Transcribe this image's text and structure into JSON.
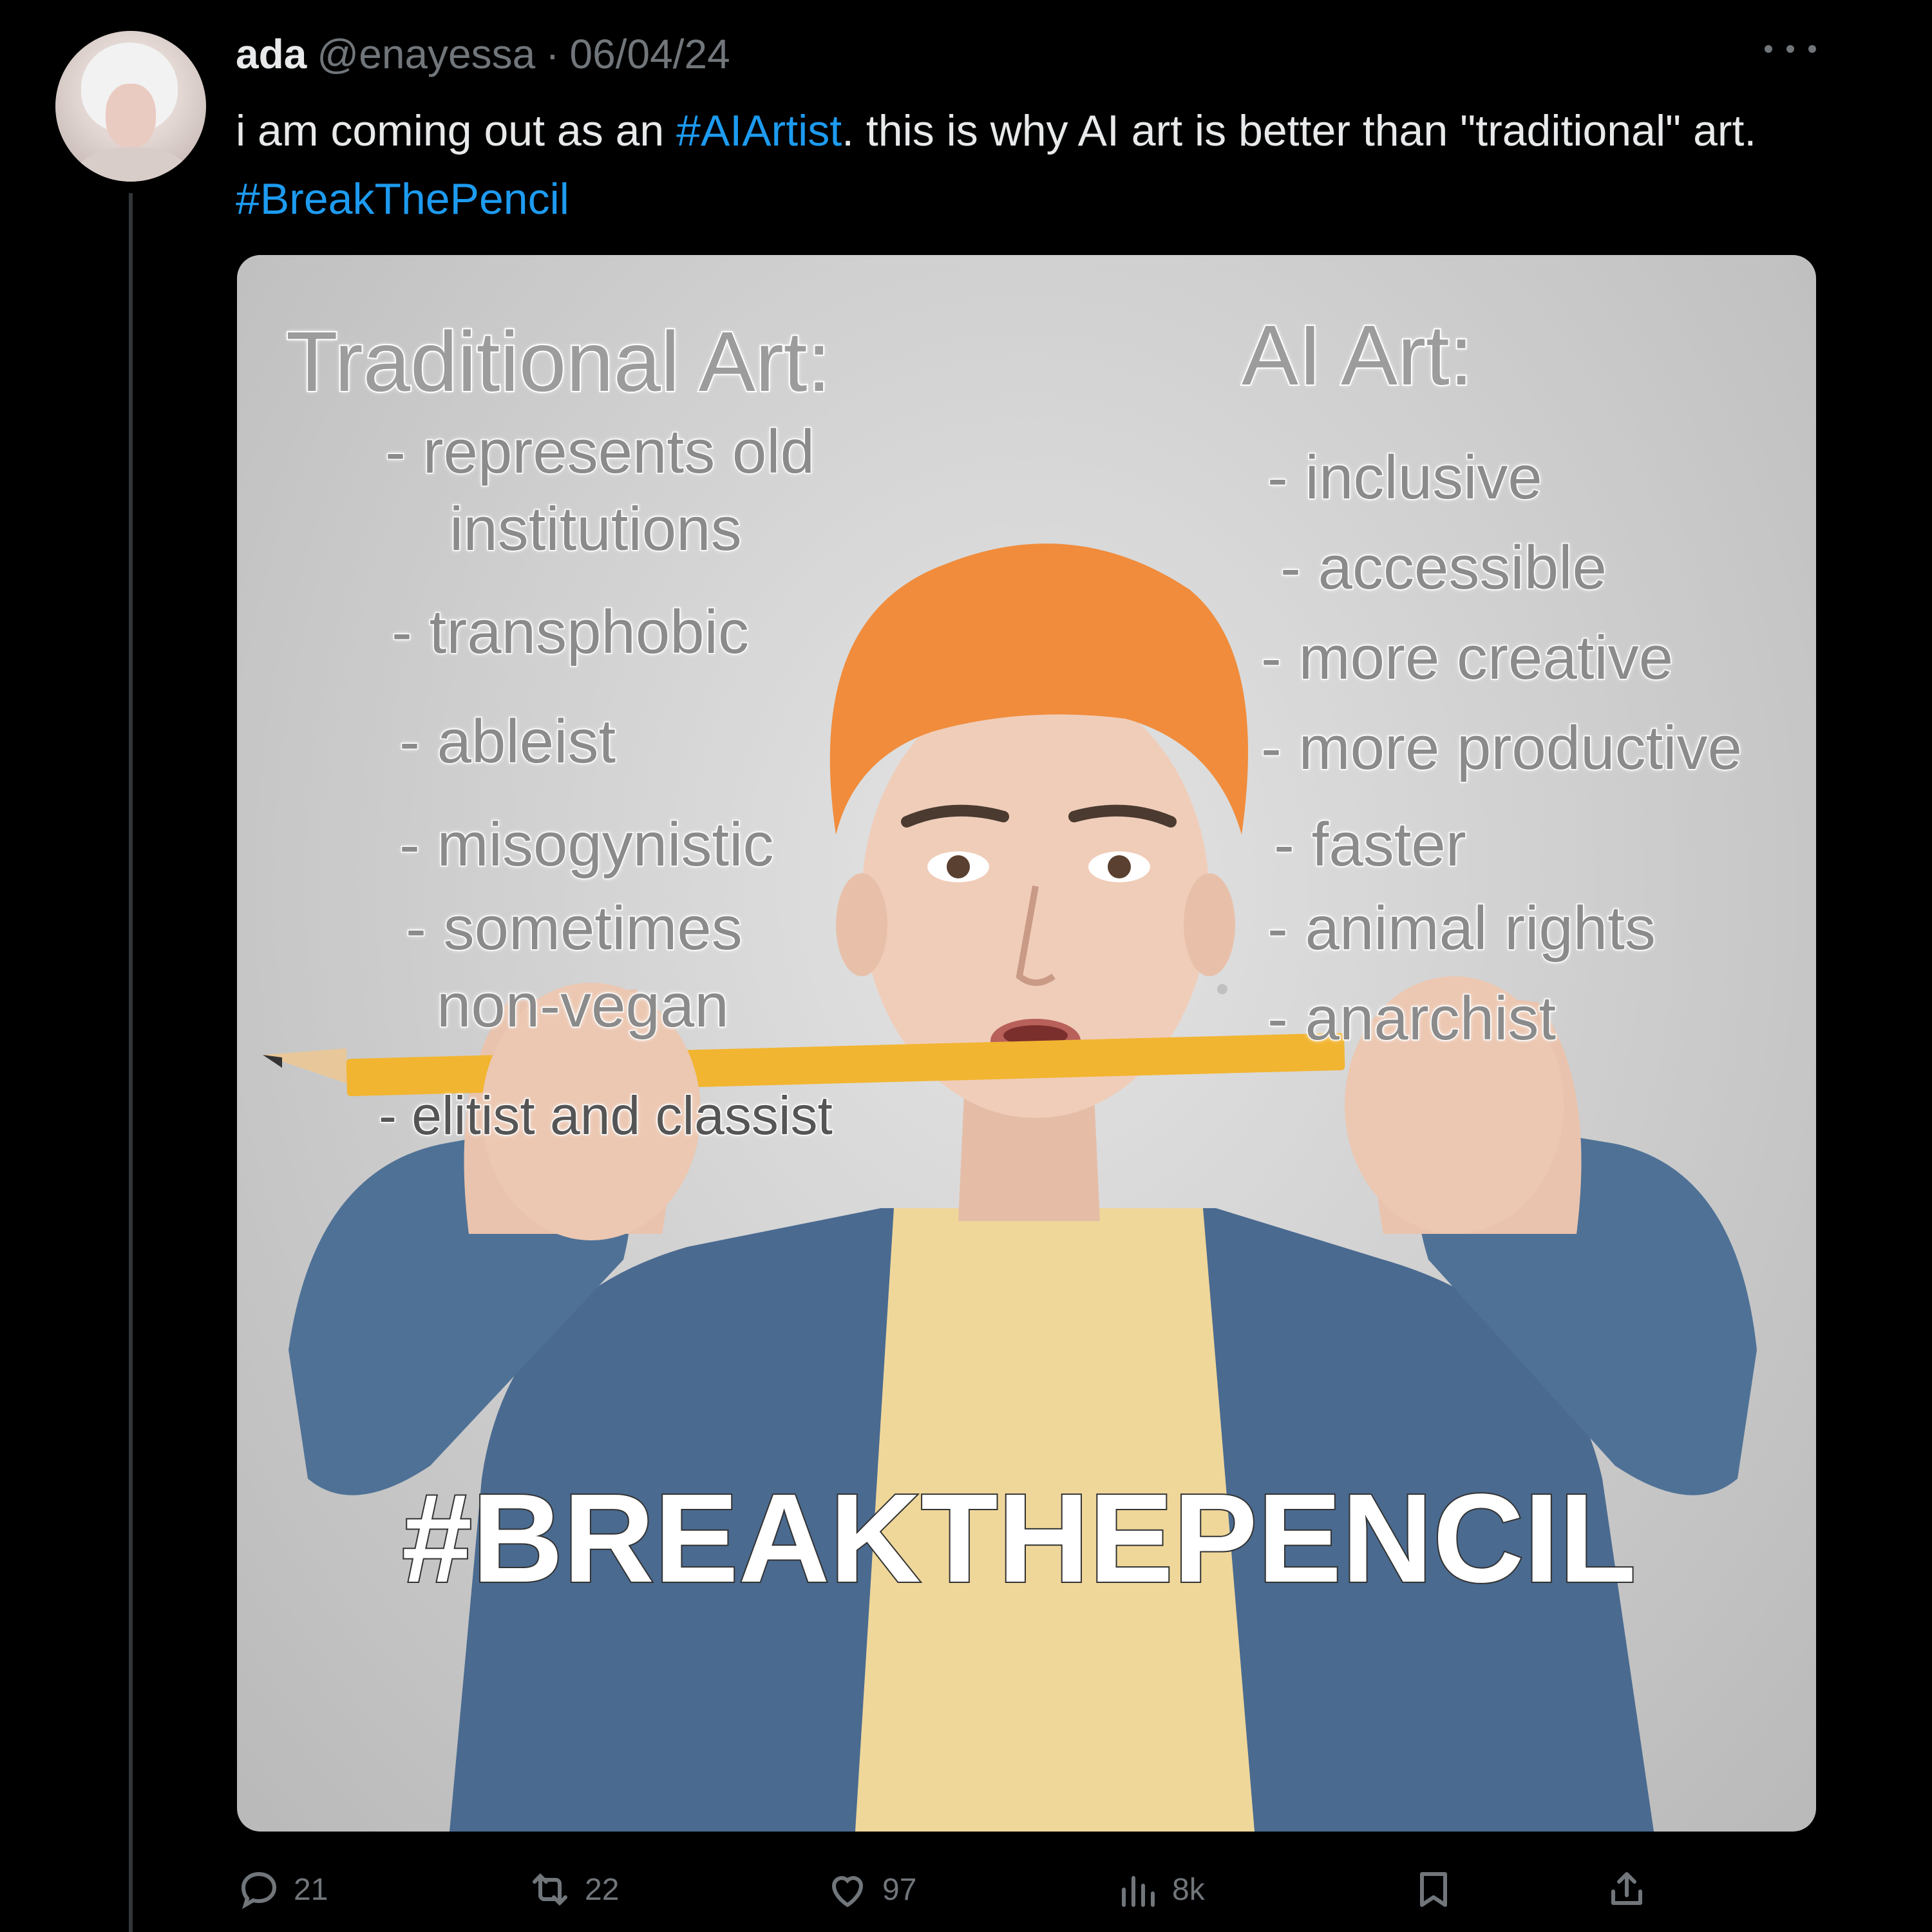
{
  "tweet": {
    "display_name": "ada",
    "handle": "@enayessa",
    "separator": "·",
    "date": "06/04/24",
    "text_part1": "i am coming out as an ",
    "hashtag1": "#AIArtist",
    "text_part2": ". this is why AI art is better than \"traditional\" art. ",
    "hashtag2": "#BreakThePencil"
  },
  "media": {
    "left_heading": "Traditional Art:",
    "left_items": [
      "- represents old",
      "institutions",
      "- transphobic",
      "- ableist",
      "- misogynistic",
      "- sometimes",
      "non-vegan",
      "- elitist and classist"
    ],
    "right_heading": "AI Art:",
    "right_items": [
      "- inclusive",
      "- accessible",
      "- more creative",
      "- more productive",
      "- faster",
      "- animal rights",
      "- anarchist"
    ],
    "banner": "#BREAKTHEPENCIL"
  },
  "actions": {
    "replies": "21",
    "reposts": "22",
    "likes": "97",
    "views": "8k"
  },
  "colors": {
    "background": "#000000",
    "text": "#e7e9ea",
    "secondary": "#71767b",
    "link": "#1d9bf0"
  }
}
